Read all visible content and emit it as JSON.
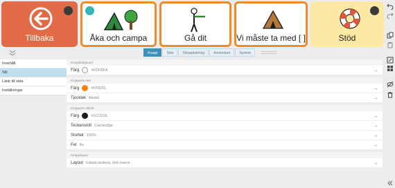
{
  "symbols": {
    "back": {
      "label": "Tillbaka"
    },
    "tiles": [
      {
        "label": "Åka och campa"
      },
      {
        "label": "Gå dit"
      },
      {
        "label": "Vi måste ta med [  ]"
      }
    ],
    "help": {
      "label": "Stöd"
    }
  },
  "tabs": [
    "Knapp",
    "Sida",
    "Sidupplattning",
    "Användare",
    "System"
  ],
  "active_tab": "Knapp",
  "nav": {
    "items": [
      "Innehåll",
      "Stil",
      "Länk till sida",
      "Inställningar"
    ],
    "active": "Stil"
  },
  "panel": {
    "background": {
      "heading": "Knappbakgrund",
      "color_label": "Färg",
      "color_value": "#FDFBFA",
      "color_hex": "#FDFBFA"
    },
    "frame": {
      "heading": "Knappens ram",
      "color_label": "Färg",
      "color_value": "#FF8201",
      "color_hex": "#FF8201",
      "thickness_label": "Tjocklek",
      "thickness_value": "Medel"
    },
    "text": {
      "heading": "Knappens etikett",
      "color_label": "Färg",
      "color_value": "#1C1D1E",
      "color_hex": "#1C1D1E",
      "font_label": "Teckensnitt",
      "font_value": "Cambridge",
      "size_label": "Storlek",
      "size_value": "100%",
      "bold_label": "Fet",
      "bold_value": "Av"
    },
    "layout": {
      "heading": "Knapplayout",
      "layout_label": "Layout",
      "layout_value": "Etikett nederst, bild överst"
    }
  },
  "colors": {
    "accent": "#3B8FB9",
    "tile_border": "#F08A2C",
    "back_tile": "#E06B46",
    "help_tile": "#FDE9A4",
    "nav_active": "#BFE0EA"
  }
}
